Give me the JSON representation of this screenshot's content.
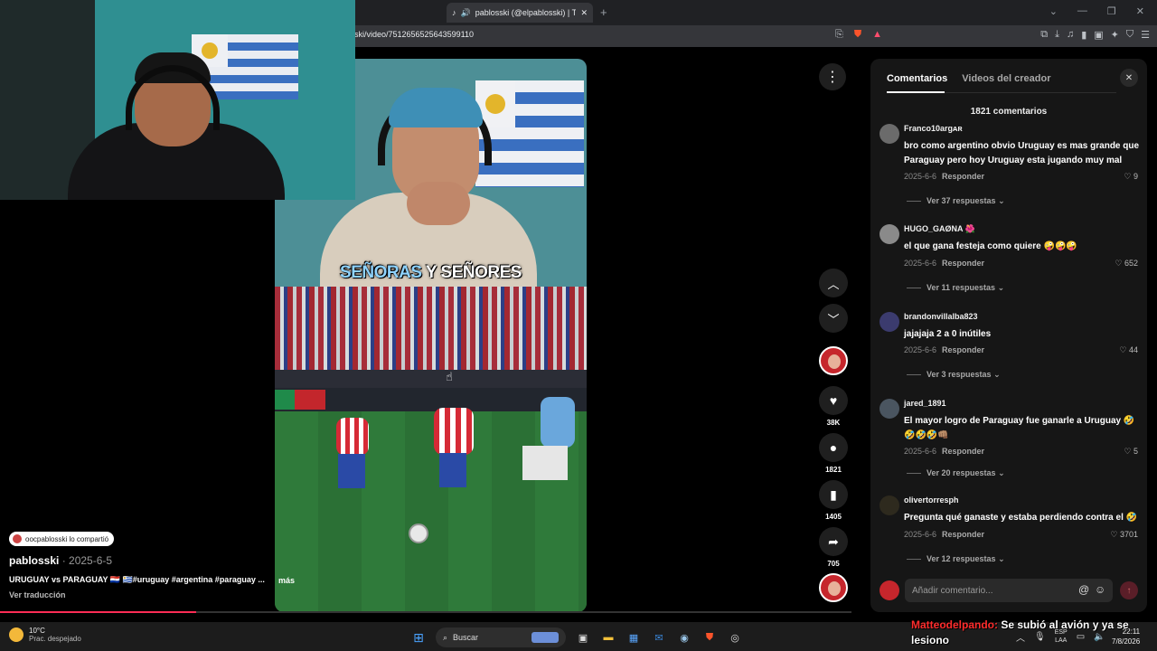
{
  "browser": {
    "tab_title": "pablosski (@elpablosski) | Ti",
    "url": "ski/video/7512656525643599110"
  },
  "video": {
    "caption_part1": "SEÑORAS",
    "caption_part2": " Y SEÑORES",
    "more_label": "más",
    "progress": 0.23
  },
  "post": {
    "shared_label": "oocpablosski lo compartió",
    "author": "pablosski",
    "date": " · 2025-6-5",
    "description": "URUGUAY vs PARAGUAY 🇵🇾 🇺🇾#uruguay #argentina #paraguay ...",
    "translate": "Ver traducción"
  },
  "actions": {
    "likes": "38K",
    "comments": "1821",
    "saves": "1405",
    "shares": "705"
  },
  "panel": {
    "tab_comments": "Comentarios",
    "tab_creator": "Videos del creador",
    "count_label": "1821 comentarios",
    "reply_label": "Responder",
    "input_placeholder": "Añadir comentario...",
    "comments": [
      {
        "user": "Franco10argᴀʀ",
        "text": "bro como argentino obvio Uruguay es mas grande que Paraguay pero hoy Uruguay esta jugando muy mal",
        "date": "2025-6-6",
        "likes": "9",
        "more": "Ver 37 respuestas"
      },
      {
        "user": "HUGO_GAØNA 🌺",
        "text": "el que gana festeja como quiere 🤪🤪🤪",
        "date": "2025-6-6",
        "likes": "652",
        "more": "Ver 11 respuestas"
      },
      {
        "user": "brandonvillalba823",
        "text": "jajajaja 2 a 0 inútiles",
        "date": "2025-6-6",
        "likes": "44",
        "more": "Ver 3 respuestas"
      },
      {
        "user": "jared_1891",
        "text": "El mayor logro de Paraguay fue ganarle a Uruguay 🤣🤣🤣🤣👊🏽",
        "date": "2025-6-6",
        "likes": "5",
        "more": "Ver 20 respuestas"
      },
      {
        "user": "olivertorresph",
        "text": "Pregunta qué ganaste y estaba perdiendo contra el 🤣",
        "date": "2025-6-6",
        "likes": "3701",
        "more": "Ver 12 respuestas"
      }
    ]
  },
  "taskbar": {
    "temp": "10°C",
    "weather": "Prac. despejado",
    "search": "Buscar",
    "lang1": "ESP",
    "lang2": "LAA",
    "time": "22:11",
    "date": "7/8/2026"
  },
  "chat": {
    "user": "Matteodelpando:",
    "message": " Se subió al avión y ya se lesiono"
  }
}
